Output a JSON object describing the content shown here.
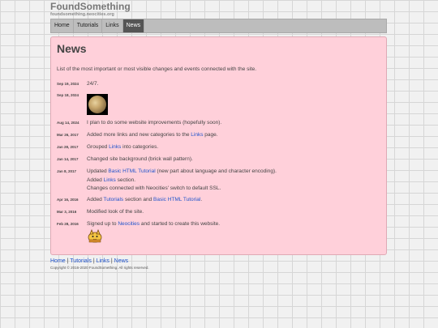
{
  "site": {
    "title": "FoundSomething",
    "domain": "foundsomething.neocities.org"
  },
  "nav": {
    "home": "Home",
    "tutorials": "Tutorials",
    "links": "Links",
    "news": "News"
  },
  "page": {
    "heading": "News",
    "intro": "List of the most important or most visible changes and events connected with the site."
  },
  "entries": [
    {
      "date": "Sep 19, 2024",
      "text": "24/7."
    },
    {
      "date": "Sep 18, 2024",
      "image": "moon-photo"
    },
    {
      "date": "Aug 14, 2024",
      "text": "I plan to do some website improvements (hopefully soon)."
    },
    {
      "date": "Mar 26, 2017",
      "pre": "Added more links and new categories to the ",
      "link": "Links",
      "post": " page."
    },
    {
      "date": "Jan 28, 2017",
      "pre": "Grouped ",
      "link": "Links",
      "post": " into categories."
    },
    {
      "date": "Jan 14, 2017",
      "text": "Changed site background (brick wall pattern)."
    },
    {
      "date": "Jan 8, 2017",
      "line1_pre": "Updated ",
      "line1_link": "Basic HTML Tutorial",
      "line1_post": " (new part about language and character encoding).",
      "line2_pre": "Added ",
      "line2_link": "Links",
      "line2_post": " section.",
      "line3": "Changes connected with Neocities' switch to default SSL."
    },
    {
      "date": "Apr 16, 2016",
      "pre": "Added ",
      "link": "Tutorials",
      "mid": " section and ",
      "link2": "Basic HTML Tutorial",
      "post": "."
    },
    {
      "date": "Mar 3, 2016",
      "text": "Modified look of the site."
    },
    {
      "date": "Feb 28, 2016",
      "pre": "Signed up to ",
      "link": "Neocities",
      "post": " and started to create this website.",
      "image": "neocities-cat"
    }
  ],
  "footer": {
    "home": "Home",
    "sep": " | ",
    "tutorials": "Tutorials",
    "links": "Links",
    "news": "News",
    "copyright": "Copyright © 2016-2020 FoundSomething. All rights reserved."
  },
  "colors": {
    "panel_bg": "#ffd0da",
    "link": "#2255cc",
    "nav_active": "#555555"
  }
}
